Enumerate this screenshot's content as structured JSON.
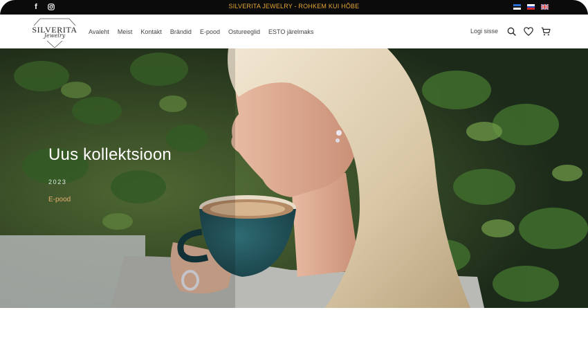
{
  "topbar": {
    "social": [
      {
        "icon": "facebook-icon",
        "glyph": "f"
      },
      {
        "icon": "instagram-icon",
        "glyph": ""
      }
    ],
    "promo_text": "SILVERITA JEWELRY - ROHKEM KUI HÕBE",
    "promo_color": "#e4a636",
    "languages": [
      {
        "code": "et",
        "icon": "flag-estonia-icon"
      },
      {
        "code": "ru",
        "icon": "flag-russia-icon"
      },
      {
        "code": "en",
        "icon": "flag-uk-icon"
      }
    ]
  },
  "header": {
    "logo": {
      "word": "SILVERITA",
      "script": "Jewelry"
    },
    "nav": [
      {
        "label": "Avaleht"
      },
      {
        "label": "Meist"
      },
      {
        "label": "Kontakt"
      },
      {
        "label": "Brändid"
      },
      {
        "label": "E-pood"
      },
      {
        "label": "Ostureeglid"
      },
      {
        "label": "ESTO järelmaks"
      }
    ],
    "login_label": "Logi sisse",
    "icons": [
      "search-icon",
      "heart-icon",
      "cart-icon"
    ]
  },
  "hero": {
    "title": "Uus kollektsioon",
    "year": "2023",
    "link_label": "E-pood",
    "link_color": "#e2b06f"
  }
}
